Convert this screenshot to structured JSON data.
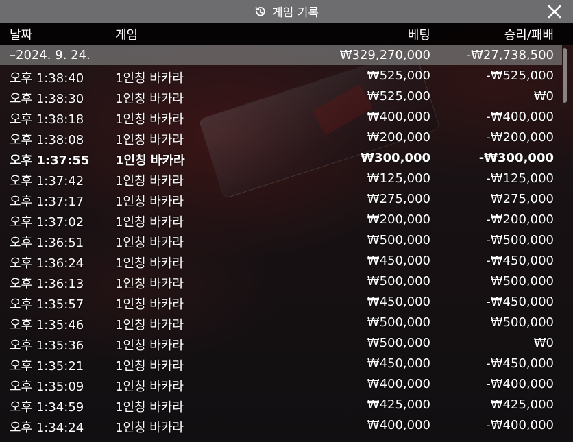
{
  "header": {
    "title": "게임 기록",
    "icon": "history-icon",
    "close_icon": "close-icon"
  },
  "columns": {
    "date": "날짜",
    "game": "게임",
    "bet": "베팅",
    "result": "승리/패배"
  },
  "summary": {
    "date": "–2024. 9. 24.",
    "bet": "₩329,270,000",
    "result": "-₩27,738,500"
  },
  "rows": [
    {
      "time": "오후 1:38:40",
      "game": "1인칭 바카라",
      "bet": "₩525,000",
      "result": "-₩525,000"
    },
    {
      "time": "오후 1:38:30",
      "game": "1인칭 바카라",
      "bet": "₩525,000",
      "result": "₩0"
    },
    {
      "time": "오후 1:38:18",
      "game": "1인칭 바카라",
      "bet": "₩400,000",
      "result": "-₩400,000"
    },
    {
      "time": "오후 1:38:08",
      "game": "1인칭 바카라",
      "bet": "₩200,000",
      "result": "-₩200,000"
    },
    {
      "time": "오후 1:37:55",
      "game": "1인칭 바카라",
      "bet": "₩300,000",
      "result": "-₩300,000"
    },
    {
      "time": "오후 1:37:42",
      "game": "1인칭 바카라",
      "bet": "₩125,000",
      "result": "-₩125,000"
    },
    {
      "time": "오후 1:37:17",
      "game": "1인칭 바카라",
      "bet": "₩275,000",
      "result": "₩275,000"
    },
    {
      "time": "오후 1:37:02",
      "game": "1인칭 바카라",
      "bet": "₩200,000",
      "result": "-₩200,000"
    },
    {
      "time": "오후 1:36:51",
      "game": "1인칭 바카라",
      "bet": "₩500,000",
      "result": "-₩500,000"
    },
    {
      "time": "오후 1:36:24",
      "game": "1인칭 바카라",
      "bet": "₩450,000",
      "result": "-₩450,000"
    },
    {
      "time": "오후 1:36:13",
      "game": "1인칭 바카라",
      "bet": "₩500,000",
      "result": "₩500,000"
    },
    {
      "time": "오후 1:35:57",
      "game": "1인칭 바카라",
      "bet": "₩450,000",
      "result": "-₩450,000"
    },
    {
      "time": "오후 1:35:46",
      "game": "1인칭 바카라",
      "bet": "₩500,000",
      "result": "₩500,000"
    },
    {
      "time": "오후 1:35:36",
      "game": "1인칭 바카라",
      "bet": "₩500,000",
      "result": "₩0"
    },
    {
      "time": "오후 1:35:21",
      "game": "1인칭 바카라",
      "bet": "₩450,000",
      "result": "-₩450,000"
    },
    {
      "time": "오후 1:35:09",
      "game": "1인칭 바카라",
      "bet": "₩400,000",
      "result": "-₩400,000"
    },
    {
      "time": "오후 1:34:59",
      "game": "1인칭 바카라",
      "bet": "₩425,000",
      "result": "₩425,000"
    },
    {
      "time": "오후 1:34:24",
      "game": "1인칭 바카라",
      "bet": "₩400,000",
      "result": "-₩400,000"
    }
  ],
  "colors": {
    "titlebar": "#6d6d70",
    "header_bg": "#000000",
    "summary_bg": "#787878",
    "text": "#ffffff"
  }
}
